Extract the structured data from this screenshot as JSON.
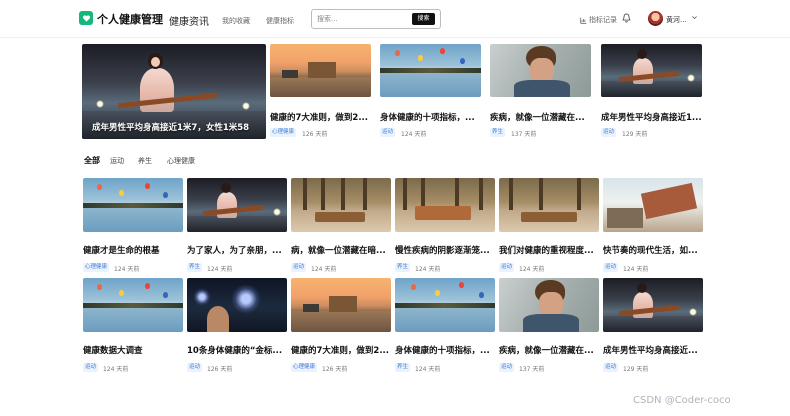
{
  "header": {
    "brand": "个人健康管理",
    "nav": [
      "健康资讯",
      "我的收藏",
      "健康指标"
    ],
    "search": {
      "placeholder": "搜索...",
      "button": "搜索"
    },
    "records_label": "指标记录",
    "user_name": "黄河...",
    "icons": {
      "logo": "heart-shield-icon",
      "records": "chart-icon",
      "bell": "bell-icon",
      "caret": "chevron-down-icon"
    }
  },
  "featured": {
    "hero_caption": "成年男性平均身高接近1米7，女性1米58",
    "cards": [
      {
        "title": "健康的7大准则，做到2...",
        "tag": "心理健康",
        "time": "126 天前"
      },
      {
        "title": "身体健康的十项指标，...",
        "tag": "运动",
        "time": "124 天前"
      },
      {
        "title": "疾病，就像一位潜藏在...",
        "tag": "养生",
        "time": "137 天前"
      },
      {
        "title": "成年男性平均身高接近1...",
        "tag": "运动",
        "time": "129 天前"
      }
    ]
  },
  "tabs": [
    "全部",
    "运动",
    "养生",
    "心理健康"
  ],
  "grid": {
    "row1": [
      {
        "title": "健康才是生命的根基",
        "tag": "心理健康",
        "time": "124 天前"
      },
      {
        "title": "为了家人，为了亲朋，...",
        "tag": "养生",
        "time": "124 天前"
      },
      {
        "title": "病，就像一位潜藏在暗...",
        "tag": "运动",
        "time": "124 天前"
      },
      {
        "title": "慢性疾病的阴影逐渐笼...",
        "tag": "养生",
        "time": "124 天前"
      },
      {
        "title": "我们对健康的重视程度...",
        "tag": "运动",
        "time": "124 天前"
      },
      {
        "title": "快节奏的现代生活，如...",
        "tag": "运动",
        "time": "124 天前"
      }
    ],
    "row2": [
      {
        "title": "健康数据大调查",
        "tag": "运动",
        "time": "124 天前"
      },
      {
        "title": "10条身体健康的“金标...",
        "tag": "运动",
        "time": "126 天前"
      },
      {
        "title": "健康的7大准则，做到2...",
        "tag": "心理健康",
        "time": "126 天前"
      },
      {
        "title": "身体健康的十项指标，...",
        "tag": "养生",
        "time": "124 天前"
      },
      {
        "title": "疾病，就像一位潜藏在...",
        "tag": "运动",
        "time": "137 天前"
      },
      {
        "title": "成年男性平均身高接近...",
        "tag": "运动",
        "time": "129 天前"
      }
    ]
  },
  "watermark": "CSDN @Coder-coco",
  "colors": {
    "accent": "#14b87a",
    "tag_text": "#3f7fd0",
    "tag_bg": "#eaf2ff"
  }
}
